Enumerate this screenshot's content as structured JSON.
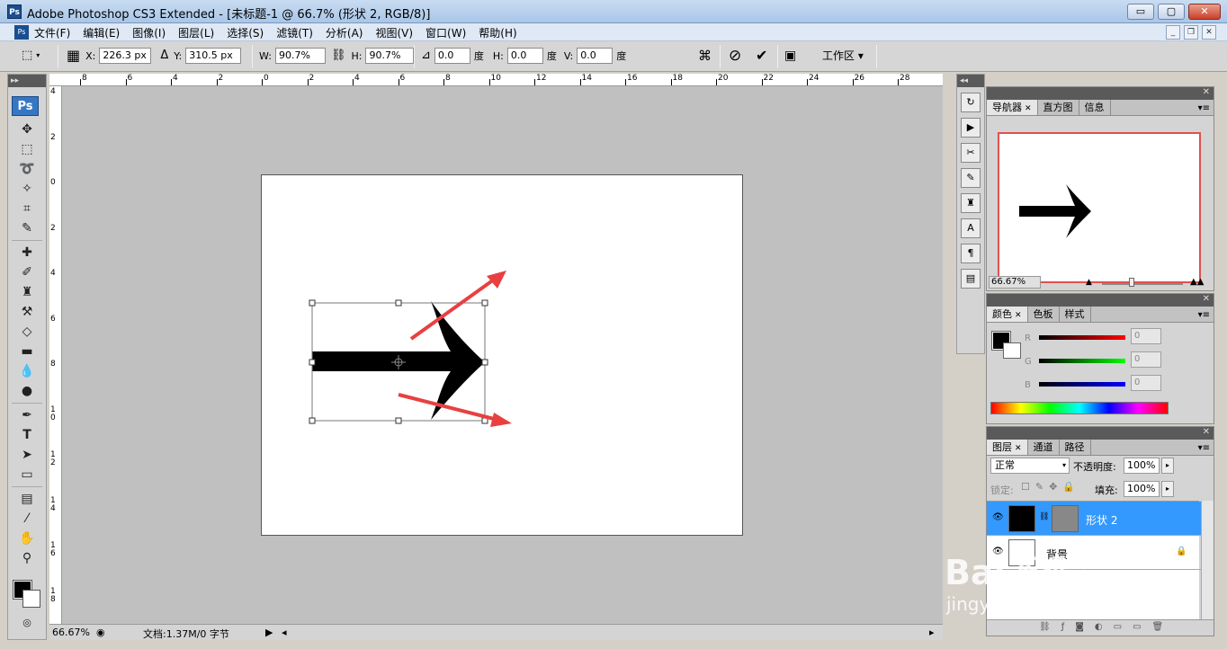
{
  "window": {
    "app_badge": "Ps",
    "title": "Adobe Photoshop CS3 Extended - [未标题-1 @ 66.7% (形状 2, RGB/8)]",
    "min_label": "▭",
    "max_label": "▢",
    "close_label": "✕"
  },
  "menu": {
    "items": [
      "文件(F)",
      "编辑(E)",
      "图像(I)",
      "图层(L)",
      "选择(S)",
      "滤镜(T)",
      "分析(A)",
      "视图(V)",
      "窗口(W)",
      "帮助(H)"
    ],
    "doc_badge": "Ps"
  },
  "options": {
    "x_label": "X:",
    "x_value": "226.3 px",
    "delta_label": "Δ",
    "y_label": "Y:",
    "y_value": "310.5 px",
    "w_label": "W:",
    "w_value": "90.7%",
    "h_label": "H:",
    "h_value": "90.7%",
    "angle_value": "0.0",
    "angle_unit": "度",
    "hskew_label": "H:",
    "hskew_value": "0.0",
    "hskew_unit": "度",
    "vskew_label": "V:",
    "vskew_value": "0.0",
    "vskew_unit": "度",
    "workspace_label": "工作区 ▾"
  },
  "rulers": {
    "top_ticks": [
      "8",
      "6",
      "4",
      "2",
      "0",
      "2",
      "4",
      "6",
      "8",
      "10",
      "12",
      "14",
      "16",
      "18",
      "20",
      "22",
      "24",
      "26",
      "28"
    ],
    "left_ticks": [
      "4",
      "2",
      "0",
      "2",
      "4",
      "6",
      "8",
      "1 0",
      "1 2",
      "1 4",
      "1 6",
      "1 8"
    ]
  },
  "status": {
    "zoom": "66.67%",
    "doc_info": "文档:1.37M/0 字节"
  },
  "toolbar": {
    "badge": "Ps"
  },
  "navigator": {
    "tabs": [
      "导航器",
      "直方图",
      "信息"
    ],
    "zoom": "66.67%"
  },
  "color_panel": {
    "tabs": [
      "颜色",
      "色板",
      "样式"
    ],
    "r_label": "R",
    "g_label": "G",
    "b_label": "B",
    "r_value": "0",
    "g_value": "0",
    "b_value": "0"
  },
  "layers_panel": {
    "tabs": [
      "图层",
      "通道",
      "路径"
    ],
    "blend_mode": "正常",
    "opacity_label": "不透明度:",
    "opacity_value": "100%",
    "lock_label": "锁定:",
    "fill_label": "填充:",
    "fill_value": "100%",
    "layers": [
      {
        "name": "形状 2",
        "selected": true
      },
      {
        "name": "背景",
        "selected": false
      }
    ]
  },
  "watermark": {
    "logo": "Bai 经验",
    "url": "jingyan.baidu.com"
  },
  "colors": {
    "accent_red": "#e84040",
    "selection_blue": "#3399ff"
  }
}
